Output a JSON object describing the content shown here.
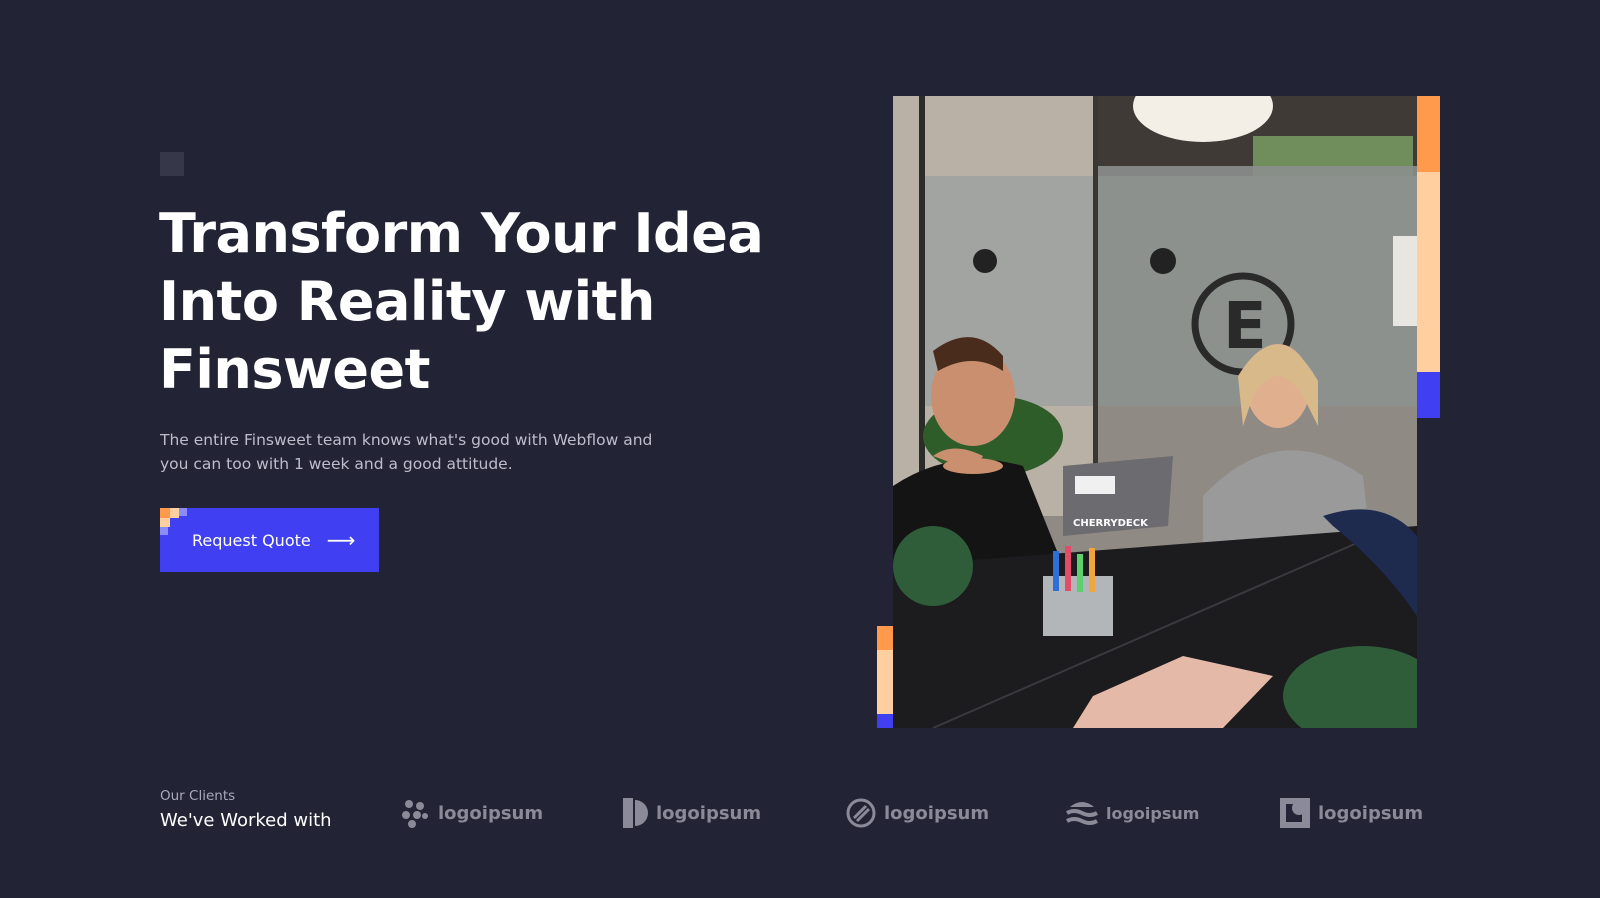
{
  "hero": {
    "title_lines": [
      "Transform Your Idea",
      "Into Reality with",
      "Finsweet"
    ],
    "subtitle_lines": [
      "The entire Finsweet team knows what's good with Webflow and",
      "you can too with 1 week and a good attitude."
    ],
    "cta_label": "Request Quote",
    "cta_arrow": "⟶"
  },
  "clients": {
    "label": "Our Clients",
    "title": "We've Worked with",
    "logos": [
      {
        "text": "logoipsum",
        "icon": "dots-cluster-logo-icon"
      },
      {
        "text": "logoipsum",
        "icon": "half-circle-logo-icon"
      },
      {
        "text": "logoipsum",
        "icon": "striped-circle-logo-icon"
      },
      {
        "text": "logoipsum",
        "icon": "waves-logo-icon"
      },
      {
        "text": "logoipsum",
        "icon": "square-circle-logo-icon"
      }
    ]
  },
  "colors": {
    "background": "#232336",
    "accent_blue": "#4040f2",
    "accent_orange": "#ff9a4d",
    "accent_peach": "#ffcfa0"
  }
}
